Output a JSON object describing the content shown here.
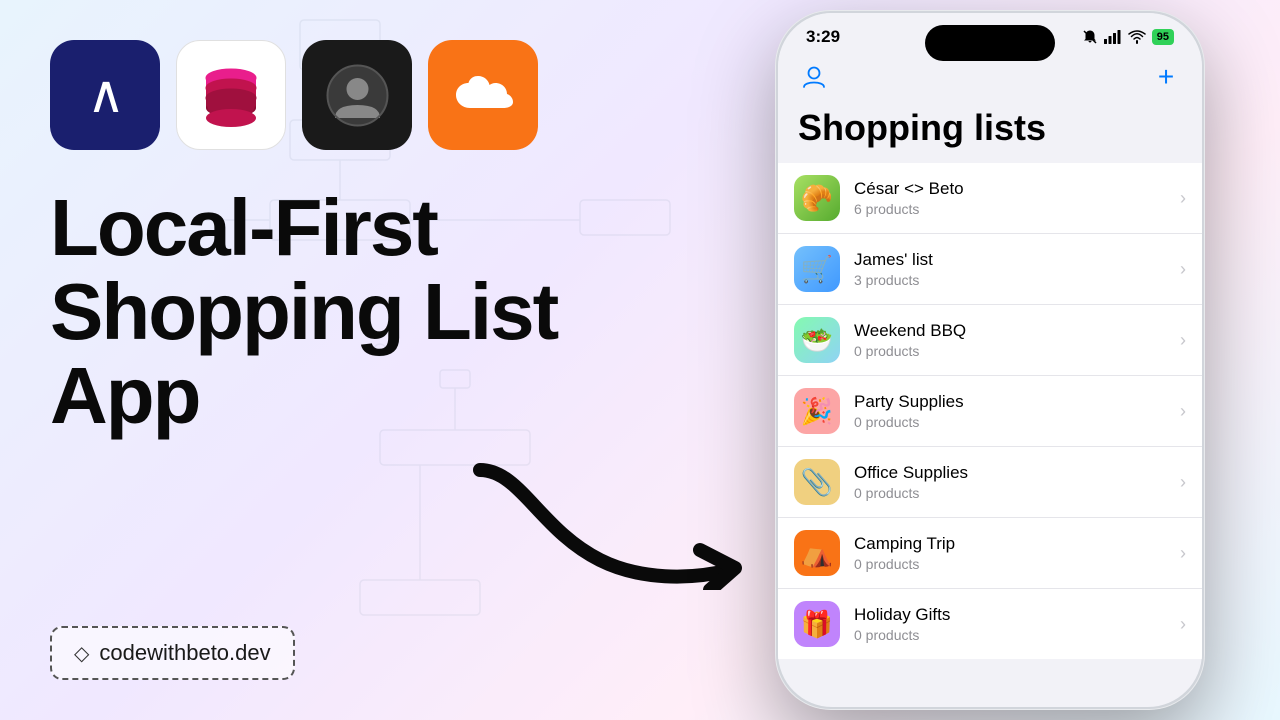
{
  "meta": {
    "title": "Local-First Shopping List App",
    "background_tagline": "codewithbeto.dev"
  },
  "hero": {
    "line1": "Local-First",
    "line2": "Shopping List",
    "line3": "App",
    "badge_text": "codewithbeto.dev"
  },
  "app_icons": [
    {
      "id": "icon-1",
      "label": "Lasso App",
      "type": "lambda"
    },
    {
      "id": "icon-2",
      "label": "DB Stack App",
      "type": "db"
    },
    {
      "id": "icon-3",
      "label": "Person Circle App",
      "type": "person"
    },
    {
      "id": "icon-4",
      "label": "Cloudflare App",
      "type": "cloud"
    }
  ],
  "phone": {
    "status_bar": {
      "time": "3:29",
      "battery": "95",
      "has_bell": true
    },
    "screen_title": "Shopping lists",
    "nav": {
      "plus_label": "+"
    },
    "shopping_lists": [
      {
        "id": "cesar-beto",
        "name": "César <> Beto",
        "count": "6 products",
        "icon": "🥐",
        "icon_class": "icon-croissant"
      },
      {
        "id": "james-list",
        "name": "James' list",
        "count": "3 products",
        "icon": "🛒",
        "icon_class": "icon-cart"
      },
      {
        "id": "weekend-bbq",
        "name": "Weekend BBQ",
        "count": "0 products",
        "icon": "🥗",
        "icon_class": "icon-bbq"
      },
      {
        "id": "party-supplies",
        "name": "Party Supplies",
        "count": "0 products",
        "icon": "🎉",
        "icon_class": "icon-party"
      },
      {
        "id": "office-supplies",
        "name": "Office Supplies",
        "count": "0 products",
        "icon": "📎",
        "icon_class": "icon-office"
      },
      {
        "id": "camping-trip",
        "name": "Camping Trip",
        "count": "0 products",
        "icon": "⛺",
        "icon_class": "icon-camping"
      },
      {
        "id": "holiday-gifts",
        "name": "Holiday Gifts",
        "count": "0 products",
        "icon": "🎁",
        "icon_class": "icon-gifts"
      }
    ]
  }
}
